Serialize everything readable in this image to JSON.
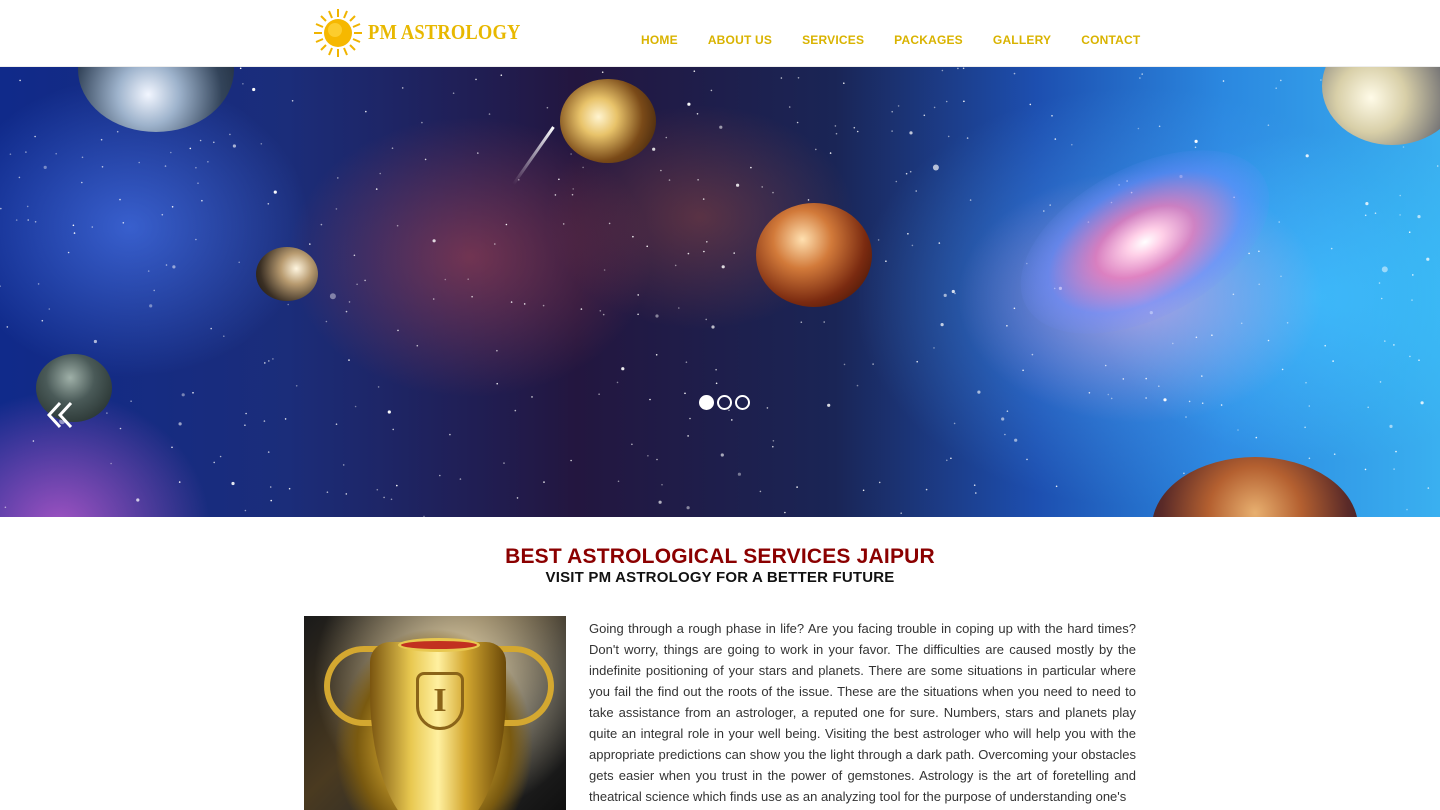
{
  "header": {
    "logo_text": "PM ASTROLOGY",
    "nav": [
      {
        "label": "HOME"
      },
      {
        "label": "ABOUT US"
      },
      {
        "label": "SERVICES"
      },
      {
        "label": "PACKAGES"
      },
      {
        "label": "GALLERY"
      },
      {
        "label": "CONTACT"
      }
    ]
  },
  "slider": {
    "prev_icon": "double-chevron-left-icon",
    "dots": 3,
    "active_dot": 1
  },
  "main": {
    "title": "BEST ASTROLOGICAL SERVICES JAIPUR",
    "subtitle": "VISIT PM ASTROLOGY FOR A BETTER FUTURE",
    "paragraph": "Going through a rough phase in life? Are you facing trouble in coping up with the hard times? Don't worry, things are going to work in your favor. The difficulties are caused mostly by the indefinite positioning of your stars and planets. There are some situations in particular where you fail the find out the roots of the issue. These are the situations when you need to need to take assistance from an astrologer, a reputed one for sure. Numbers, stars and planets play quite an integral role in your well being. Visiting the best astrologer who will help you with the appropriate predictions can show you the light through a dark path. Overcoming your obstacles gets easier when you trust in the power of gemstones. Astrology is the art of foretelling and theatrical science which finds use as an analyzing tool for the purpose of understanding one's"
  },
  "colors": {
    "brand": "#e8b800",
    "nav": "#d9b300",
    "title": "#8b0000"
  }
}
